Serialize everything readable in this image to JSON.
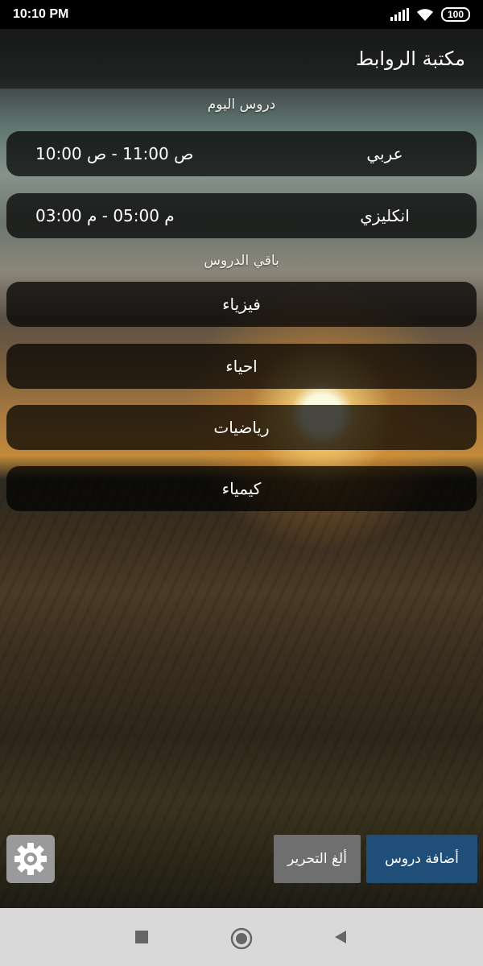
{
  "status": {
    "time": "10:10 PM",
    "battery": "100"
  },
  "appbar": {
    "title": "مكتبة الروابط"
  },
  "today": {
    "heading": "دروس اليوم",
    "items": [
      {
        "subject": "عربي",
        "time": "ص 11:00 - ص 10:00"
      },
      {
        "subject": "انكليزي",
        "time": "م 05:00 - م 03:00"
      }
    ]
  },
  "others": {
    "heading": "باقي الدروس",
    "items": [
      "فيزياء",
      "احياء",
      "رياضيات",
      "كيمياء"
    ]
  },
  "actions": {
    "cancel_label": "ألغ التحرير",
    "add_label": "أضافة دروس"
  },
  "icons": {
    "settings": "gear-icon",
    "nav_recent": "square-icon",
    "nav_home": "circle-icon",
    "nav_back": "triangle-back-icon"
  },
  "colors": {
    "add_button": "#1f4e79",
    "cancel_button": "#6f6f6f",
    "settings_button": "#9a9a9a"
  }
}
